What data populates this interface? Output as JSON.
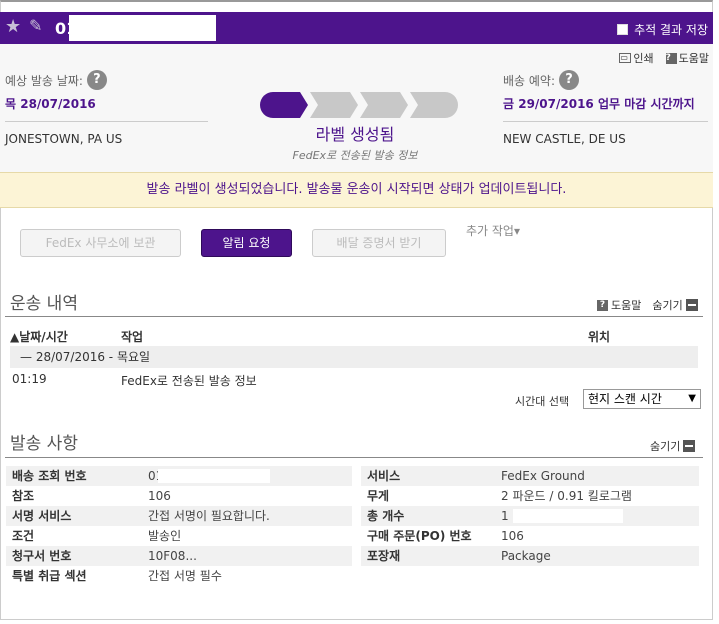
{
  "topbar": {
    "tracking_number_visible": "01",
    "save_result_label": "추적 결과 저장"
  },
  "header": {
    "print_label": "인쇄",
    "help_label": "도움말",
    "ship_date_label": "예상 발송 날짜:",
    "ship_date_value": "목 28/07/2016",
    "origin": "JONESTOWN, PA US",
    "delivery_label": "배송 예약:",
    "delivery_value": "금 29/07/2016 업무 마감 시간까지",
    "destination": "NEW CASTLE, DE US",
    "status_title": "라벨 생성됨",
    "status_subtitle": "FedEx로 전송된 발송 정보",
    "progress_step": 1,
    "progress_total": 4
  },
  "banner": {
    "message": "발송 라벨이 생성되었습니다. 발송물 운송이 시작되면 상태가 업데이트됩니다."
  },
  "actions": {
    "hold_at_office": "FedEx 사무소에 보관",
    "request_alert": "알림 요청",
    "proof_of_delivery": "배달 증명서 받기",
    "more_actions": "추가 작업▾"
  },
  "travel_history": {
    "title": "운송 내역",
    "help": "도움말",
    "hide": "숨기기",
    "col_datetime": "▲날짜/시간",
    "col_activity": "작업",
    "col_location": "위치",
    "day_label": "—    28/07/2016 - 목요일",
    "events": [
      {
        "time": "01:19",
        "activity": "FedEx로 전송된 발송 정보",
        "location": ""
      }
    ],
    "timezone_label": "시간대 선택",
    "timezone_value": "현지 스캔 시간"
  },
  "shipment_facts": {
    "title": "발송 사항",
    "hide": "숨기기",
    "left": [
      {
        "key": "배송 조회 번호",
        "value": "01"
      },
      {
        "key": "참조",
        "value": "106"
      },
      {
        "key": "서명 서비스",
        "value": "간접 서명이 필요합니다."
      },
      {
        "key": "조건",
        "value": "발송인"
      },
      {
        "key": "청구서 번호",
        "value": "10F08..."
      },
      {
        "key": "특별 취급 섹션",
        "value": "간접 서명 필수"
      }
    ],
    "right": [
      {
        "key": "서비스",
        "value": "FedEx Ground"
      },
      {
        "key": "무게",
        "value": "2 파운드 / 0.91 킬로그램"
      },
      {
        "key": "총 개수",
        "value": "1"
      },
      {
        "key": "구매 주문(PO) 번호",
        "value": "106"
      },
      {
        "key": "포장재",
        "value": "Package"
      }
    ]
  },
  "colors": {
    "brand_purple": "#4d148c",
    "progress_done": "#4d148c",
    "progress_pending": "#c8c8c8",
    "banner_bg": "#fcf4d6"
  }
}
